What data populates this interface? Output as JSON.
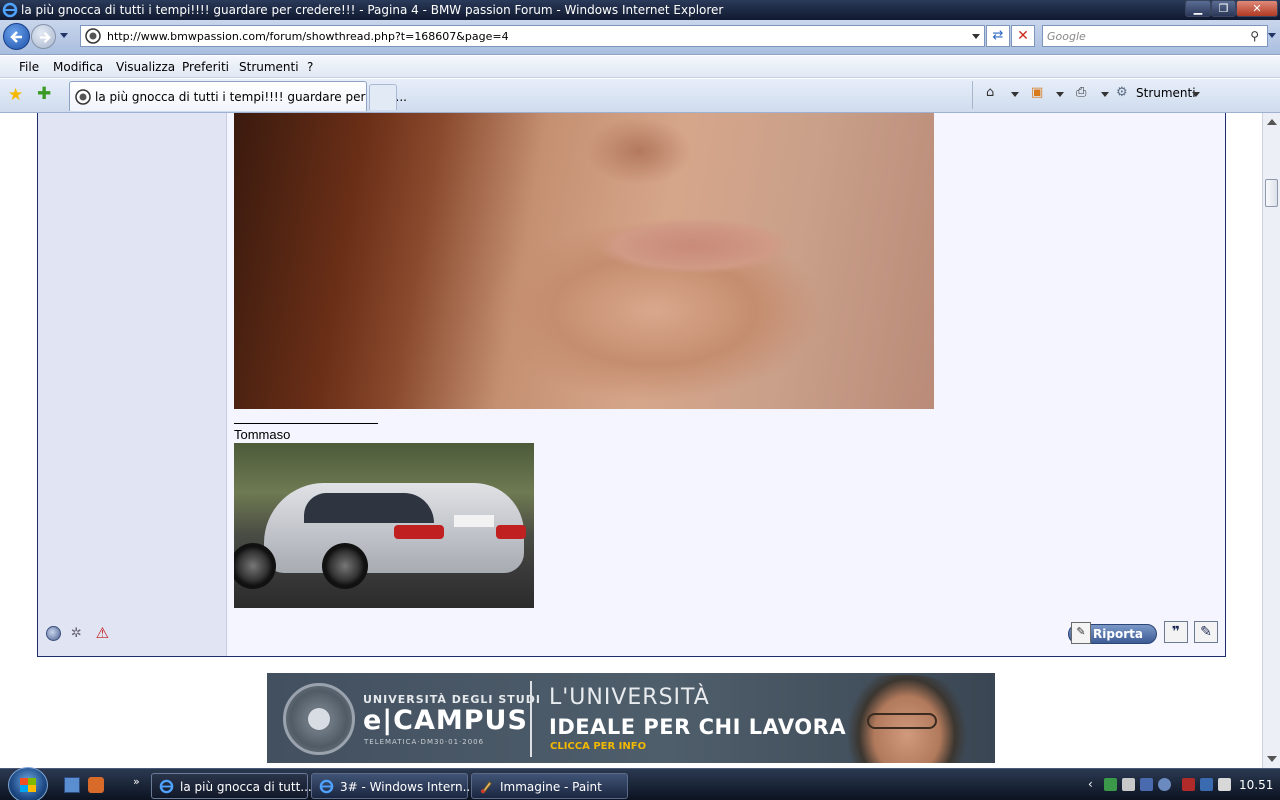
{
  "window": {
    "title": "la più gnocca di tutti i tempi!!!! guardare per credere!!! - Pagina 4 - BMW passion Forum - Windows Internet Explorer"
  },
  "address_bar": {
    "url": "http://www.bmwpassion.com/forum/showthread.php?t=168607&page=4",
    "search_placeholder": "Google"
  },
  "menu": {
    "items": [
      "File",
      "Modifica",
      "Visualizza",
      "Preferiti",
      "Strumenti",
      "?"
    ]
  },
  "tabs": {
    "active_label": "la più gnocca di tutti i tempi!!!! guardare per cred..."
  },
  "command_bar": {
    "tools_label": "Strumenti"
  },
  "post": {
    "signature_name": "Tommaso",
    "report_label": "Riporta"
  },
  "banner": {
    "uni_small": "UNIVERSITÀ DEGLI STUDI",
    "brand": "e|CAMPUS",
    "telematica": "TELEMATICA·DM30·01·2006",
    "headline1": "L'UNIVERSITÀ",
    "headline2": "IDEALE PER CHI LAVORA",
    "cta": "CLICCA PER INFO"
  },
  "taskbar": {
    "buttons": [
      {
        "label": "la più gnocca di tutt..."
      },
      {
        "label": "3# - Windows Intern..."
      },
      {
        "label": "Immagine - Paint"
      }
    ],
    "clock": "10.51"
  }
}
